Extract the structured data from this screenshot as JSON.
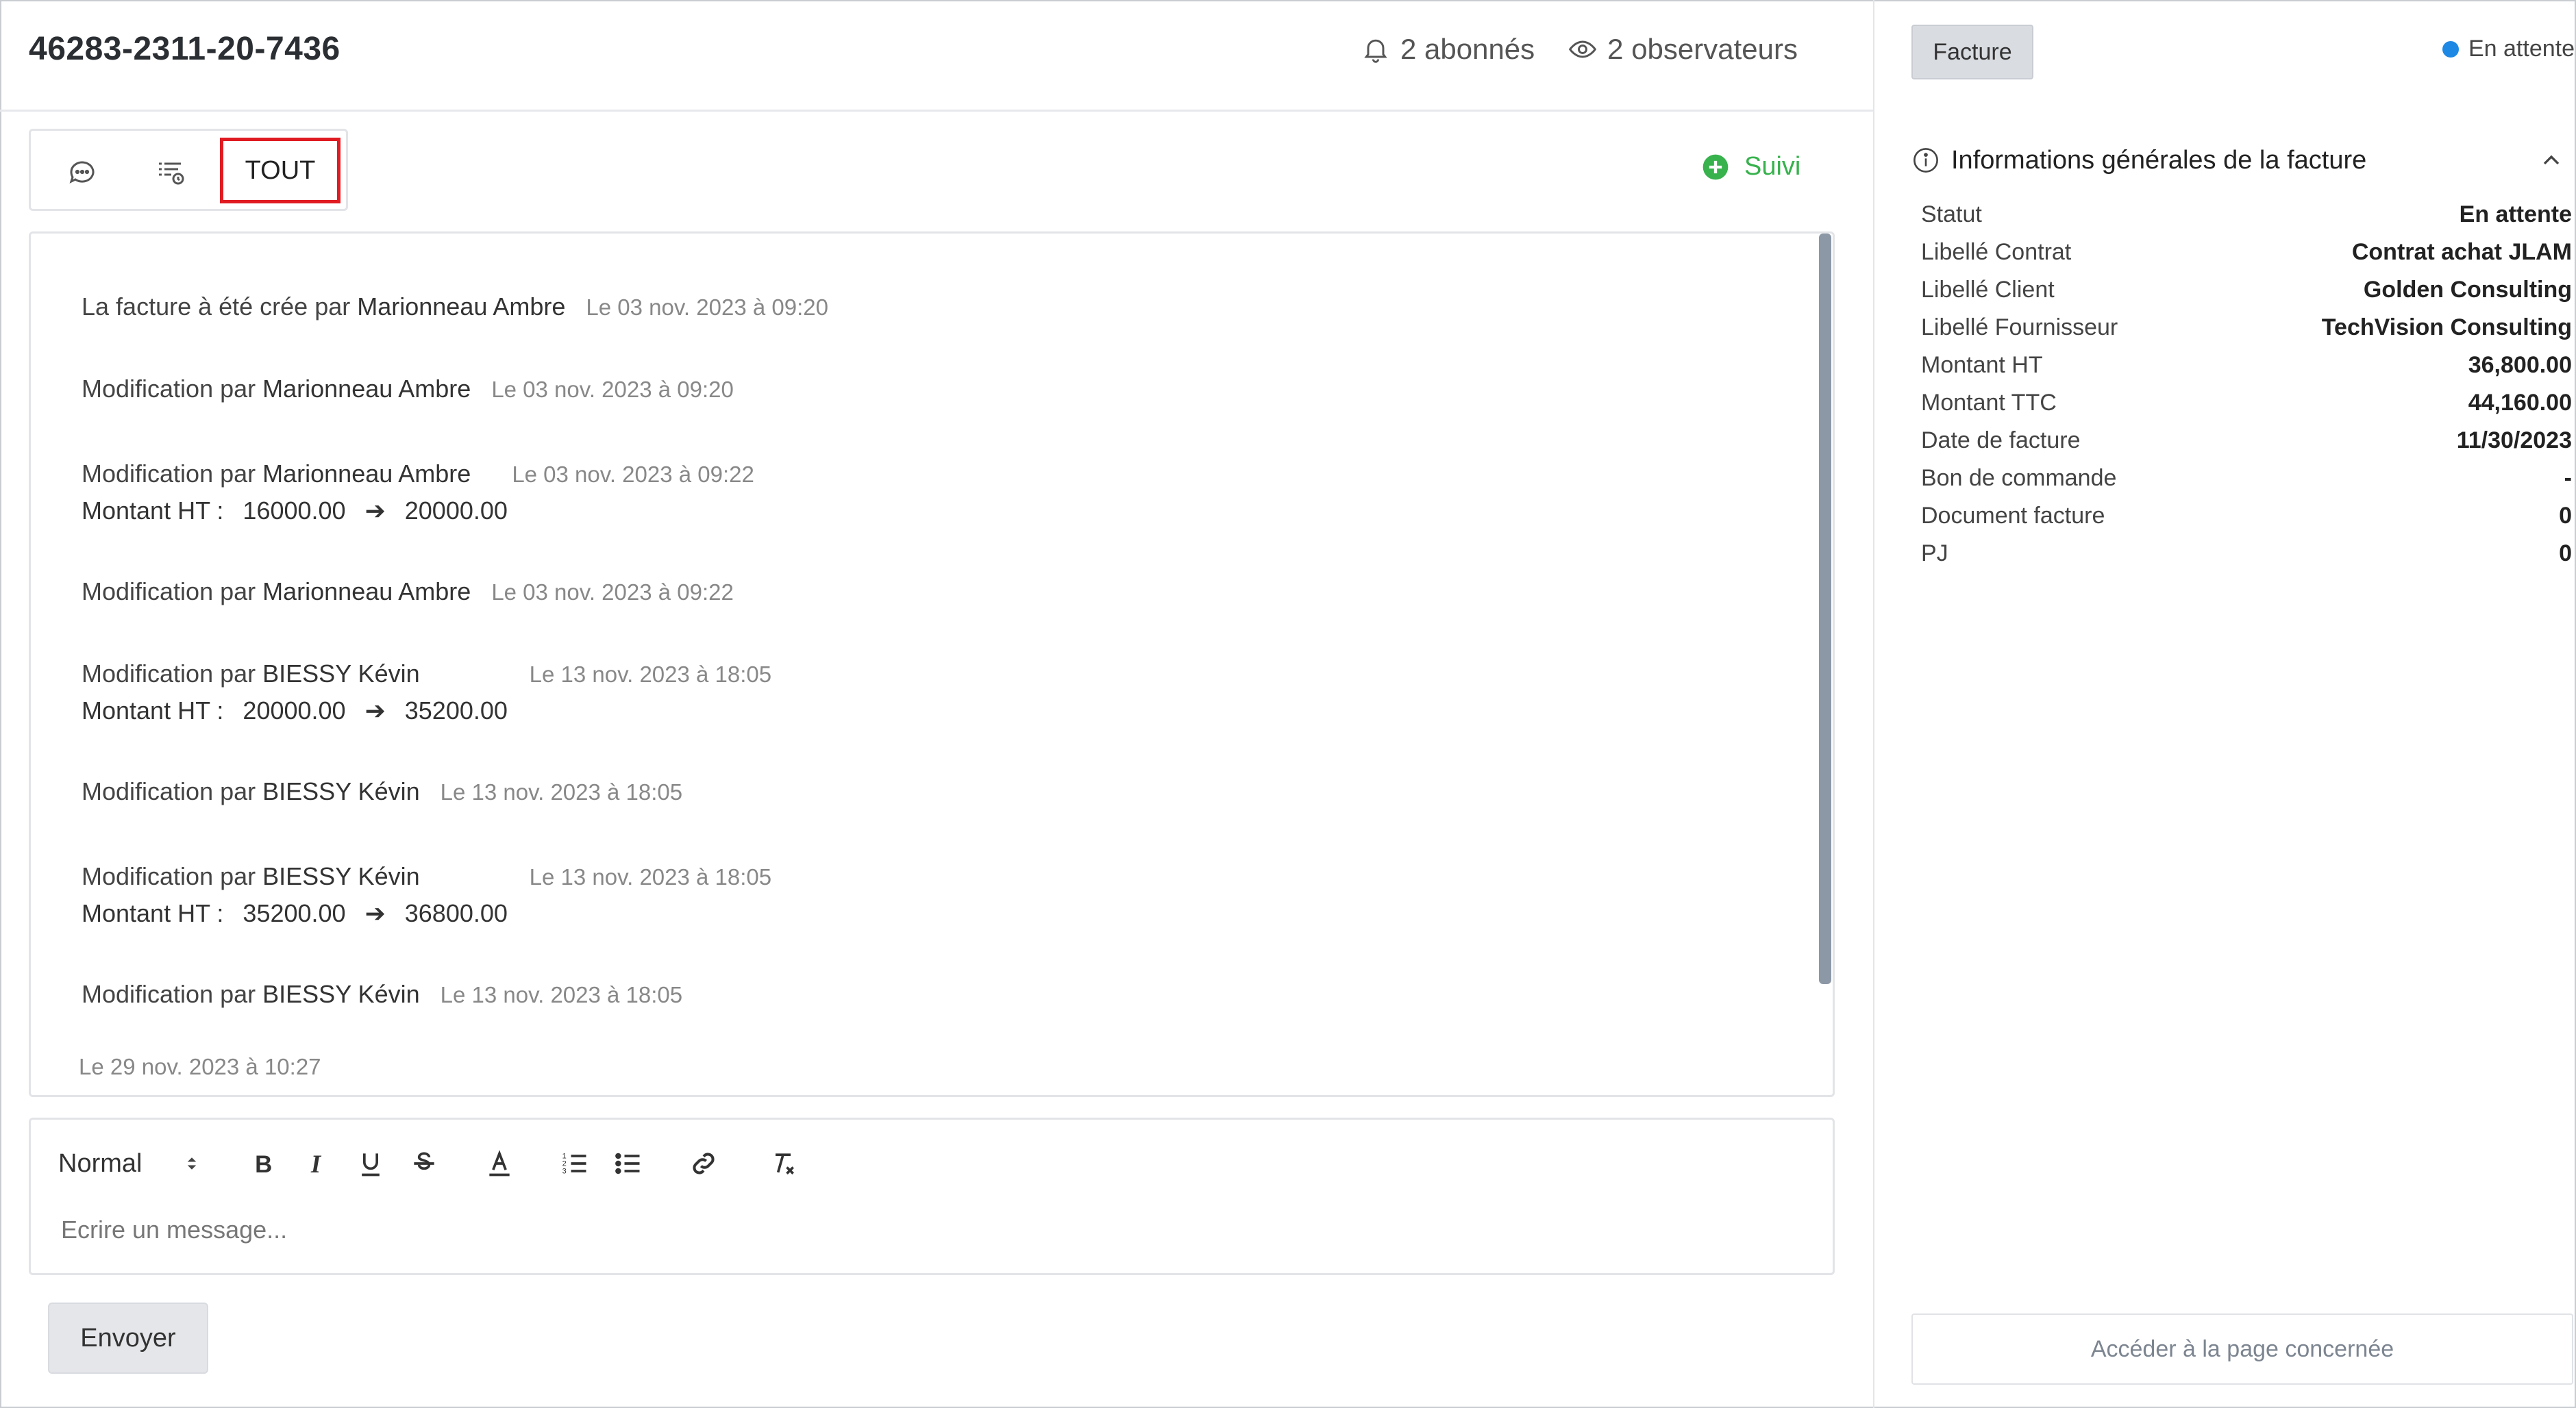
{
  "header": {
    "title": "46283-2311-20-7436",
    "subscribers": "2 abonnés",
    "observers": "2 observateurs"
  },
  "tabs": {
    "all_label": "TOUT"
  },
  "follow_label": "Suivi",
  "timeline": [
    {
      "text": "La facture à été crée par",
      "user": "Marionneau Ambre",
      "date": "Le 03 nov. 2023 à 09:20"
    },
    {
      "text": "Modification par",
      "user": "Marionneau Ambre",
      "date": "Le 03 nov. 2023 à 09:20"
    },
    {
      "text": "Modification par",
      "user": "Marionneau Ambre",
      "date": "Le 03 nov. 2023 à 09:22",
      "field": "Montant HT :",
      "from": "16000.00",
      "to": "20000.00"
    },
    {
      "text": "Modification par",
      "user": "Marionneau Ambre",
      "date": "Le 03 nov. 2023 à 09:22"
    },
    {
      "text": "Modification par",
      "user": "BIESSY Kévin",
      "date": "Le 13 nov. 2023 à 18:05",
      "field": "Montant HT :",
      "from": "20000.00",
      "to": "35200.00"
    },
    {
      "text": "Modification par",
      "user": "BIESSY Kévin",
      "date": "Le 13 nov. 2023 à 18:05"
    },
    {
      "text": "Modification par",
      "user": "BIESSY Kévin",
      "date": "Le 13 nov. 2023 à 18:05",
      "field": "Montant HT :",
      "from": "35200.00",
      "to": "36800.00"
    },
    {
      "text": "Modification par",
      "user": "BIESSY Kévin",
      "date": "Le 13 nov. 2023 à 18:05"
    },
    {
      "date_only": "Le 29 nov. 2023 à 10:27"
    }
  ],
  "editor": {
    "format_label": "Normal",
    "placeholder": "Ecrire un message..."
  },
  "send_label": "Envoyer",
  "right": {
    "doc_type": "Facture",
    "status_label": "En attente",
    "status_color": "#1e88e5",
    "section_title": "Informations générales de la facture",
    "fields": [
      {
        "k": "Statut",
        "v": "En attente"
      },
      {
        "k": "Libellé Contrat",
        "v": "Contrat achat JLAM"
      },
      {
        "k": "Libellé Client",
        "v": "Golden Consulting"
      },
      {
        "k": "Libellé Fournisseur",
        "v": "TechVision Consulting"
      },
      {
        "k": "Montant HT",
        "v": "36,800.00"
      },
      {
        "k": "Montant TTC",
        "v": "44,160.00"
      },
      {
        "k": "Date de facture",
        "v": "11/30/2023"
      },
      {
        "k": "Bon de commande",
        "v": "-"
      },
      {
        "k": "Document facture",
        "v": "0"
      },
      {
        "k": "PJ",
        "v": "0"
      }
    ],
    "goto_label": "Accéder à la page concernée"
  }
}
